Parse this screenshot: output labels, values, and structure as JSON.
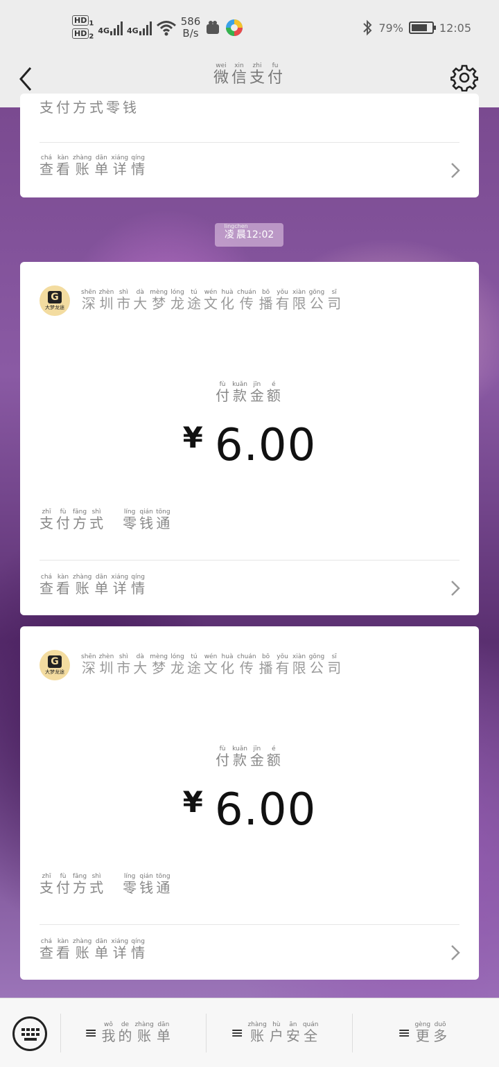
{
  "status_bar": {
    "hd1": "HD",
    "hd1_sub": "1",
    "hd2": "HD",
    "hd2_sub": "2",
    "sig1": "4G",
    "sig2": "4G",
    "net_speed": "586",
    "net_unit": "B/s",
    "battery": "79%",
    "battery_level": 0.79,
    "time": "12:05"
  },
  "header": {
    "title_chars": [
      "微",
      "信",
      "支",
      "付"
    ],
    "title_pinyin": [
      "wei",
      "xin",
      "zhi",
      "fu"
    ]
  },
  "time_chip": {
    "chars": [
      "凌",
      "晨"
    ],
    "pinyin": [
      "ling",
      "chen"
    ],
    "time": "12:02"
  },
  "labels": {
    "amount_label_chars": [
      "付",
      "款",
      "金",
      "额"
    ],
    "amount_label_pinyin": [
      "fù",
      "kuǎn",
      "jīn",
      "é"
    ],
    "pay_method_chars": [
      "支",
      "付",
      "方",
      "式"
    ],
    "pay_method_pinyin": [
      "zhī",
      "fù",
      "fāng",
      "shì"
    ],
    "pay_method_value_chars": [
      "零",
      "钱",
      "通"
    ],
    "pay_method_value_pinyin": [
      "líng",
      "qián",
      "tōng"
    ],
    "details_chars": [
      "查",
      "看",
      "账",
      "单",
      "详",
      "情"
    ],
    "details_pinyin": [
      "chá",
      "kàn",
      "zhàng",
      "dān",
      "xiáng",
      "qíng"
    ],
    "partial_chars": [
      "支",
      "付",
      "方",
      "式",
      "零",
      "钱"
    ]
  },
  "merchant": {
    "name_chars": [
      "深",
      "圳",
      "市",
      "大",
      "梦",
      "龙",
      "途",
      "文",
      "化",
      "传",
      "播",
      "有",
      "限",
      "公",
      "司"
    ],
    "name_pinyin": [
      "shēn",
      "zhèn",
      "shì",
      "dà",
      "mèng",
      "lóng",
      "tú",
      "wén",
      "huà",
      "chuán",
      "bō",
      "yǒu",
      "xiàn",
      "gōng",
      "sī"
    ],
    "logo_letter": "G",
    "logo_text": "大梦龙途"
  },
  "cards": [
    {
      "currency": "¥",
      "amount": "6.00"
    },
    {
      "currency": "¥",
      "amount": "6.00"
    }
  ],
  "bottom_menu": [
    {
      "chars": [
        "我",
        "的",
        "账",
        "单"
      ],
      "pinyin": [
        "wǒ",
        "de",
        "zhàng",
        "dān"
      ]
    },
    {
      "chars": [
        "账",
        "户",
        "安",
        "全"
      ],
      "pinyin": [
        "zhàng",
        "hù",
        "ān",
        "quán"
      ]
    },
    {
      "chars": [
        "更",
        "多"
      ],
      "pinyin": [
        "gèng",
        "duō"
      ]
    }
  ],
  "icons": {
    "back": "back-arrow-icon",
    "settings": "gear-icon",
    "chevron": "chevron-right-icon",
    "keyboard": "keyboard-icon",
    "menu": "hamburger-icon"
  }
}
